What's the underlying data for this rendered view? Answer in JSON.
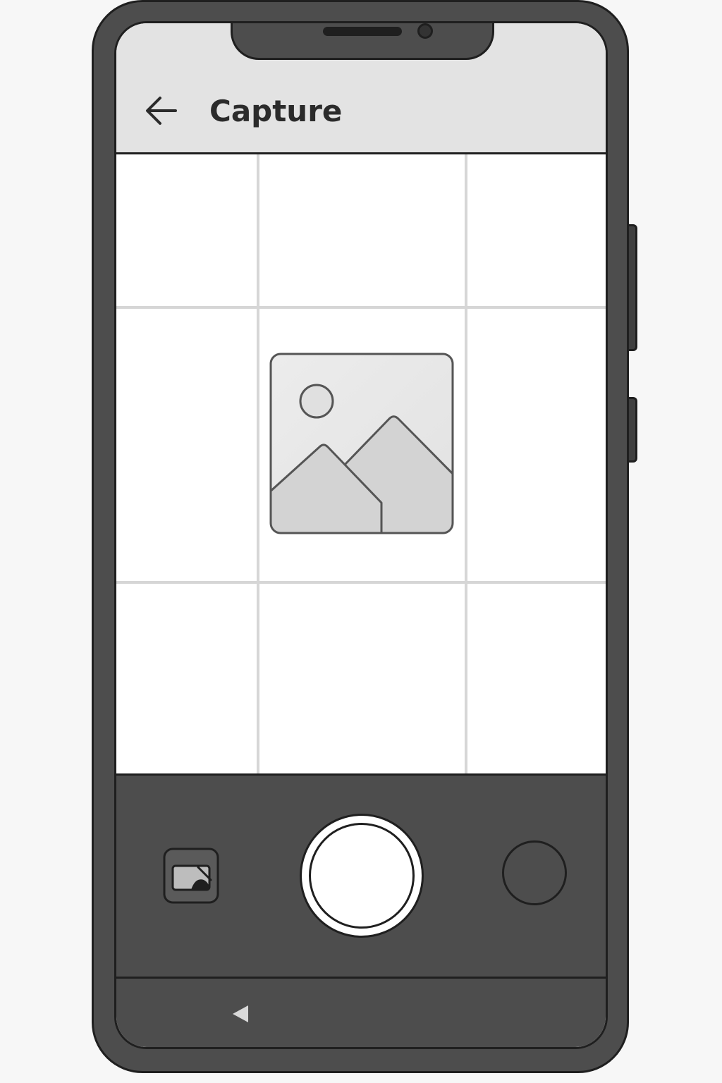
{
  "app_bar": {
    "title": "Capture",
    "back_icon": "arrow-left-icon"
  },
  "viewfinder": {
    "grid": "3x3",
    "placeholder_icon": "image-placeholder-icon"
  },
  "controls": {
    "gallery_icon": "gallery-icon",
    "shutter_icon": "shutter-icon",
    "switch_camera_icon": "circle-icon"
  },
  "system_nav": {
    "back_icon": "triangle-back-icon"
  },
  "colors": {
    "frame": "#4d4d4d",
    "outline": "#1f1f1f",
    "app_bar_bg": "#e3e3e3",
    "grid_line": "#d6d6d6",
    "screen_bg": "#ffffff"
  }
}
